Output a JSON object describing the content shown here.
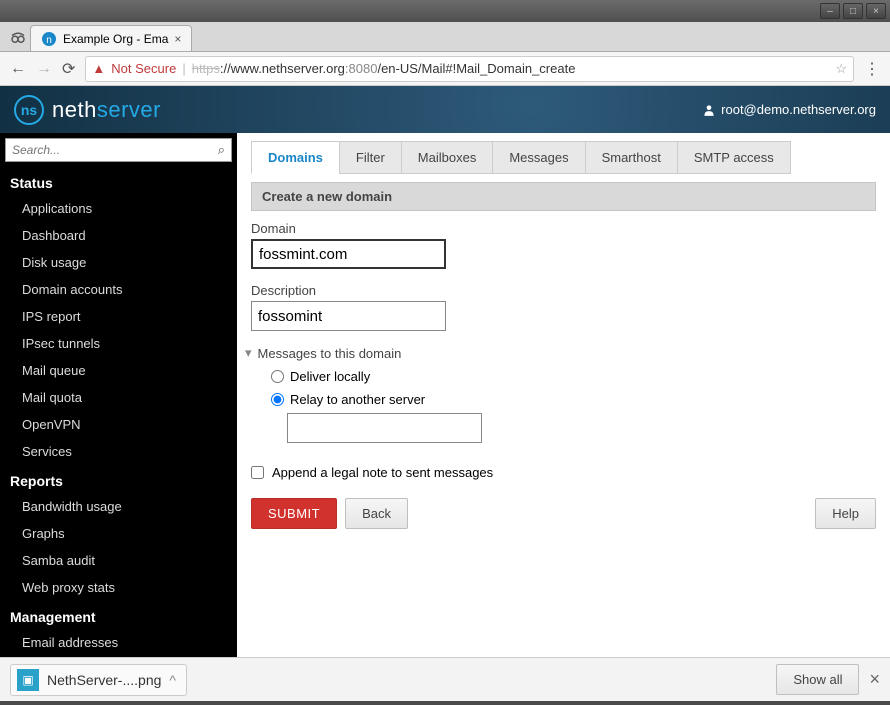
{
  "window": {
    "min": "–",
    "max": "□",
    "close": "×"
  },
  "browser": {
    "tab_title": "Example Org - Ema",
    "not_secure": "Not Secure",
    "url_scheme": "https",
    "url_host": "www.nethserver.org",
    "url_port": ":8080",
    "url_path": "/en-US/Mail#!Mail_Domain_create"
  },
  "header": {
    "brand_a": "neth",
    "brand_b": "server",
    "user": "root@demo.nethserver.org"
  },
  "sidebar": {
    "search_placeholder": "Search...",
    "s1": "Status",
    "s1_items": [
      "Applications",
      "Dashboard",
      "Disk usage",
      "Domain accounts",
      "IPS report",
      "IPsec tunnels",
      "Mail queue",
      "Mail quota",
      "OpenVPN",
      "Services"
    ],
    "s2": "Reports",
    "s2_items": [
      "Bandwidth usage",
      "Graphs",
      "Samba audit",
      "Web proxy stats"
    ],
    "s3": "Management",
    "s3_items": [
      "Email addresses"
    ]
  },
  "tabs": [
    "Domains",
    "Filter",
    "Mailboxes",
    "Messages",
    "Smarthost",
    "SMTP access"
  ],
  "panel": {
    "title": "Create a new domain",
    "domain_label": "Domain",
    "domain_value": "fossmint.com",
    "desc_label": "Description",
    "desc_value": "fossomint",
    "group": "Messages to this domain",
    "opt1": "Deliver locally",
    "opt2": "Relay to another server",
    "relay_value": "",
    "append_label": "Append a legal note to sent messages",
    "submit": "SUBMIT",
    "back": "Back",
    "help": "Help"
  },
  "download": {
    "file": "NethServer-....png",
    "showall": "Show all"
  }
}
